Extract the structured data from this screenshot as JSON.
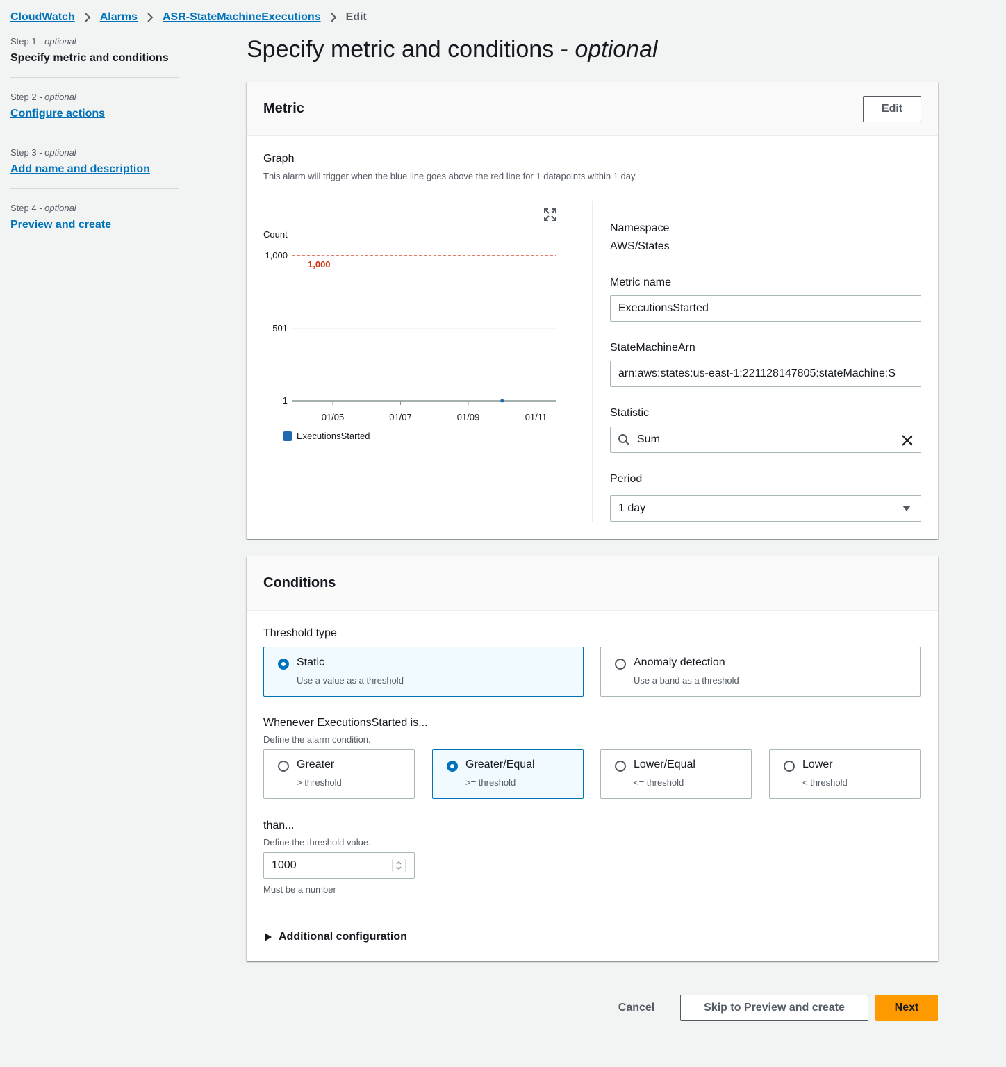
{
  "breadcrumb": {
    "items": [
      "CloudWatch",
      "Alarms",
      "ASR-StateMachineExecutions"
    ],
    "current": "Edit"
  },
  "steps": [
    {
      "num": "Step 1",
      "opt": "optional",
      "title": "Specify metric and conditions"
    },
    {
      "num": "Step 2",
      "opt": "optional",
      "title": "Configure actions"
    },
    {
      "num": "Step 3",
      "opt": "optional",
      "title": "Add name and description"
    },
    {
      "num": "Step 4",
      "opt": "optional",
      "title": "Preview and create"
    }
  ],
  "page": {
    "title": "Specify metric and conditions - ",
    "title_italic": "optional"
  },
  "metric": {
    "heading": "Metric",
    "edit_label": "Edit",
    "graph_label": "Graph",
    "graph_desc": "This alarm will trigger when the blue line goes above the red line for 1 datapoints within 1 day.",
    "namespace_label": "Namespace",
    "namespace_value": "AWS/States",
    "metric_name_label": "Metric name",
    "metric_name_value": "ExecutionsStarted",
    "arn_label": "StateMachineArn",
    "arn_value": "arn:aws:states:us-east-1:221128147805:stateMachine:S",
    "statistic_label": "Statistic",
    "statistic_value": "Sum",
    "period_label": "Period",
    "period_value": "1 day"
  },
  "chart_data": {
    "type": "line",
    "ylabel": "Count",
    "y_ticks": [
      "1,000",
      "501",
      "1"
    ],
    "x_ticks": [
      "01/05",
      "01/07",
      "01/09",
      "01/11"
    ],
    "threshold": 1000,
    "threshold_label": "1,000",
    "series": [
      {
        "name": "ExecutionsStarted",
        "color": "#1f69b1",
        "points": [
          {
            "x": "01/10",
            "y": 1
          }
        ]
      }
    ],
    "threshold_color": "#d13212"
  },
  "conditions": {
    "heading": "Conditions",
    "threshold_type_label": "Threshold type",
    "threshold_types": [
      {
        "title": "Static",
        "desc": "Use a value as a threshold",
        "selected": true
      },
      {
        "title": "Anomaly detection",
        "desc": "Use a band as a threshold",
        "selected": false
      }
    ],
    "whenever_label": "Whenever ExecutionsStarted is...",
    "whenever_desc": "Define the alarm condition.",
    "operators": [
      {
        "title": "Greater",
        "desc": "> threshold",
        "selected": false
      },
      {
        "title": "Greater/Equal",
        "desc": ">= threshold",
        "selected": true
      },
      {
        "title": "Lower/Equal",
        "desc": "<= threshold",
        "selected": false
      },
      {
        "title": "Lower",
        "desc": "< threshold",
        "selected": false
      }
    ],
    "than_label": "than...",
    "than_desc": "Define the threshold value.",
    "threshold_value": "1000",
    "threshold_hint": "Must be a number",
    "additional_label": "Additional configuration"
  },
  "footer": {
    "cancel": "Cancel",
    "skip": "Skip to Preview and create",
    "next": "Next"
  },
  "colors": {
    "accent": "#0073bb",
    "primary_button": "#ff9900"
  }
}
